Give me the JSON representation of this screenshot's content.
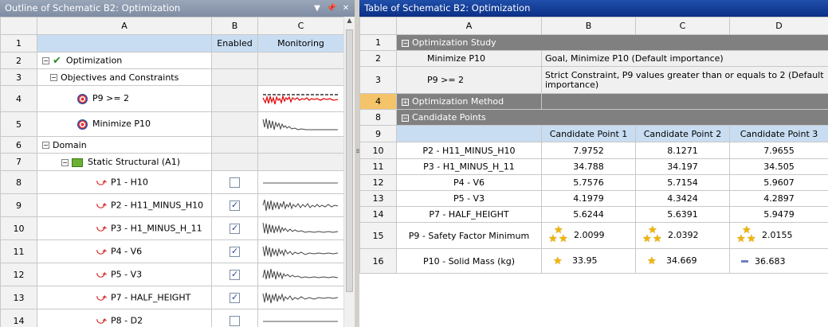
{
  "left_pane": {
    "title": "Outline of Schematic B2: Optimization",
    "col_headers": [
      "A",
      "B",
      "C"
    ],
    "row1": {
      "num": "1",
      "b": "Enabled",
      "c": "Monitoring"
    },
    "rows": [
      {
        "num": "2",
        "label": "Optimization"
      },
      {
        "num": "3",
        "label": "Objectives and Constraints"
      },
      {
        "num": "4",
        "label": "P9 >= 2"
      },
      {
        "num": "5",
        "label": "Minimize P10"
      },
      {
        "num": "6",
        "label": "Domain"
      },
      {
        "num": "7",
        "label": "Static Structural (A1)"
      },
      {
        "num": "8",
        "label": "P1 - H10",
        "enabled": false
      },
      {
        "num": "9",
        "label": "P2 - H11_MINUS_H10",
        "enabled": true
      },
      {
        "num": "10",
        "label": "P3 - H1_MINUS_H_11",
        "enabled": true
      },
      {
        "num": "11",
        "label": "P4 - V6",
        "enabled": true
      },
      {
        "num": "12",
        "label": "P5 - V3",
        "enabled": true
      },
      {
        "num": "13",
        "label": "P7 - HALF_HEIGHT",
        "enabled": true
      },
      {
        "num": "14",
        "label": "P8 - D2",
        "enabled": false
      }
    ]
  },
  "right_pane": {
    "title": "Table of Schematic B2: Optimization",
    "col_headers": [
      "A",
      "B",
      "C",
      "D"
    ],
    "sections": {
      "optimization_study": {
        "num": "1",
        "label": "Optimization Study"
      },
      "optimization_method": {
        "num": "4",
        "label": "Optimization Method"
      },
      "candidate_points": {
        "num": "8",
        "label": "Candidate Points"
      }
    },
    "study_rows": [
      {
        "num": "2",
        "name": "Minimize P10",
        "desc": "Goal, Minimize P10 (Default importance)"
      },
      {
        "num": "3",
        "name": "P9 >= 2",
        "desc": "Strict Constraint, P9 values greater than or equals to 2 (Default importance)"
      }
    ],
    "candidate_header": {
      "num": "9",
      "c1": "Candidate Point 1",
      "c2": "Candidate Point 2",
      "c3": "Candidate Point 3"
    },
    "candidate_rows": [
      {
        "num": "10",
        "name": "P2 - H11_MINUS_H10",
        "v": [
          "7.9752",
          "8.1271",
          "7.9655"
        ]
      },
      {
        "num": "11",
        "name": "P3 - H1_MINUS_H_11",
        "v": [
          "34.788",
          "34.197",
          "34.505"
        ]
      },
      {
        "num": "12",
        "name": "P4 - V6",
        "v": [
          "5.7576",
          "5.7154",
          "5.9607"
        ]
      },
      {
        "num": "13",
        "name": "P5 - V3",
        "v": [
          "4.1979",
          "4.3424",
          "4.2897"
        ]
      },
      {
        "num": "14",
        "name": "P7 - HALF_HEIGHT",
        "v": [
          "5.6244",
          "5.6391",
          "5.9479"
        ]
      }
    ],
    "safety_row": {
      "num": "15",
      "name": "P9 - Safety Factor Minimum",
      "v": [
        "2.0099",
        "2.0392",
        "2.0155"
      ],
      "rating_stars": [
        3,
        3,
        3
      ]
    },
    "mass_row": {
      "num": "16",
      "name": "P10 - Solid Mass (kg)",
      "v": [
        "33.95",
        "34.669",
        "36.683"
      ],
      "rating_stars": [
        1,
        1,
        0
      ]
    }
  },
  "colors": {
    "header_blue": "#c9ddf2",
    "section_gray": "#808080",
    "selected_row": "#f4c36a",
    "title_active": "#0b2f86",
    "title_inactive": "#8390a6",
    "star": "#f2b600"
  }
}
